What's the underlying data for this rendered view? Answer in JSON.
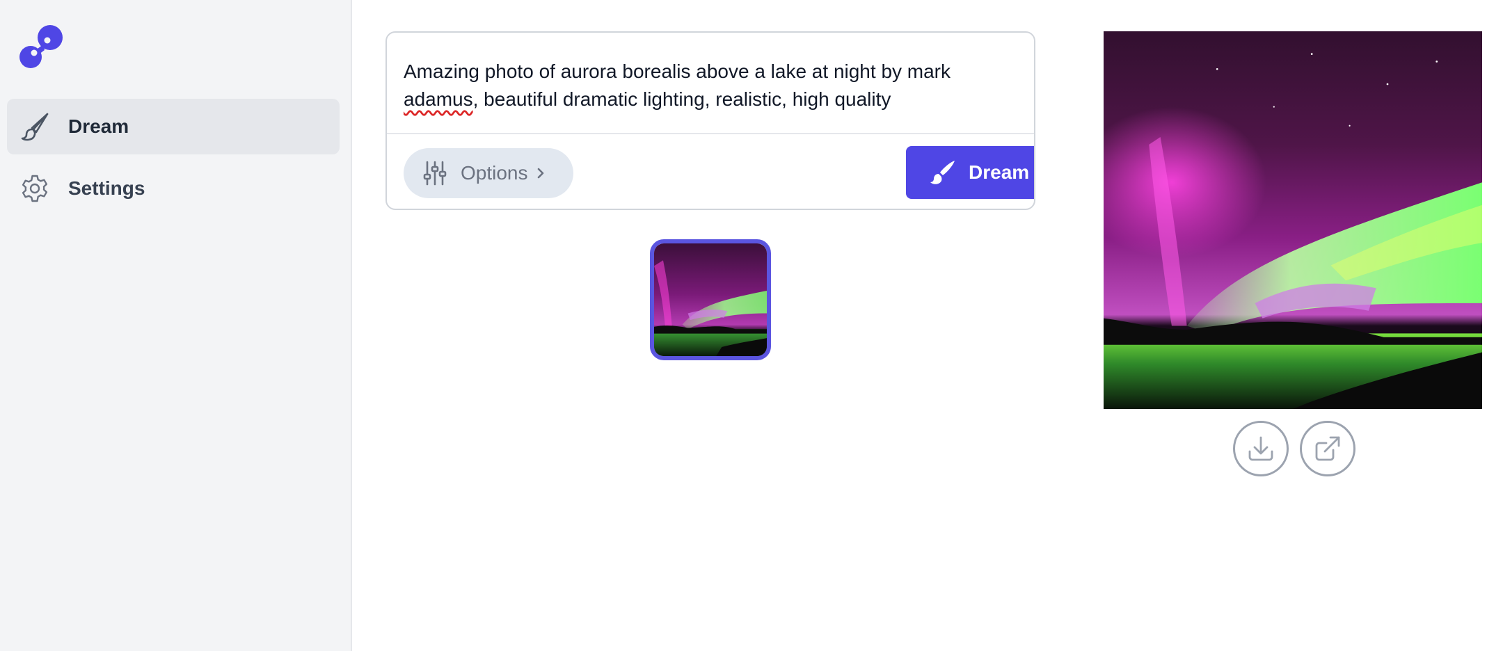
{
  "sidebar": {
    "logo_icon": "infinity-logo-icon",
    "items": [
      {
        "label": "Dream",
        "icon": "paintbrush-icon",
        "active": true
      },
      {
        "label": "Settings",
        "icon": "gear-icon",
        "active": false
      }
    ]
  },
  "prompt": {
    "text_before": "Amazing photo of aurora borealis above a lake at night by mark ",
    "text_misspelled": "adamus",
    "text_after": ", beautiful dramatic lighting, realistic, high quality"
  },
  "toolbar": {
    "options_label": "Options",
    "options_icon": "sliders-icon",
    "dream_label": "Dream",
    "dream_icon": "paintbrush-icon"
  },
  "gallery": {
    "thumbnail_subject": "aurora-borealis-thumbnail",
    "selected": true
  },
  "preview": {
    "image_subject": "aurora-borealis-image",
    "download_icon": "download-icon",
    "open_external_icon": "external-link-icon"
  },
  "colors": {
    "accent": "#4f46e5",
    "sidebar_bg": "#f3f4f6",
    "active_item_bg": "#e5e7eb",
    "options_bg": "#e2e8f0"
  }
}
